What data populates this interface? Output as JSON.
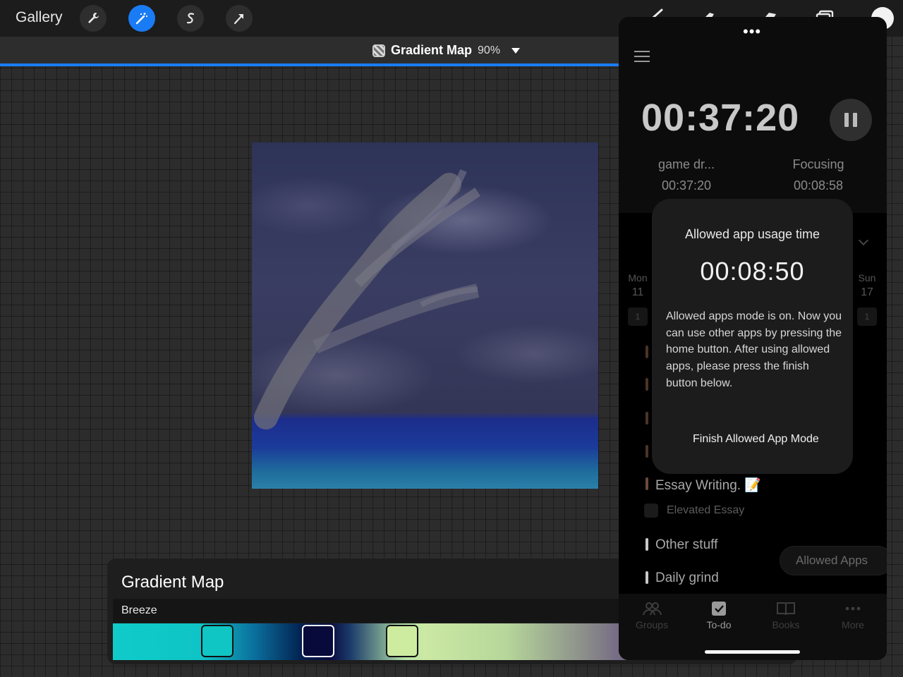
{
  "topbar": {
    "gallery_label": "Gallery",
    "tools": [
      {
        "icon": "wrench-icon"
      },
      {
        "icon": "magic-wand-icon"
      },
      {
        "icon": "selection-s-icon"
      },
      {
        "icon": "transform-arrow-icon"
      }
    ],
    "right_tools": [
      "brush-icon",
      "smudge-icon",
      "eraser-icon",
      "layers-icon",
      "color-circle"
    ]
  },
  "layer": {
    "name": "Gradient Map",
    "percent": "90%"
  },
  "gradient_panel": {
    "title": "Gradient Map",
    "preset_name": "Breeze",
    "stop_colors": [
      "#0fc6c4",
      "#070a3a",
      "#cdeca0"
    ]
  },
  "phone": {
    "main_timer": "00:37:20",
    "stats": [
      {
        "label": "game dr...",
        "value": "00:37:20"
      },
      {
        "label": "Focusing",
        "value": "00:08:58"
      }
    ],
    "week": {
      "start_day": "Mon",
      "start_num": "11",
      "start_count": "1",
      "end_day": "Sun",
      "end_num": "17",
      "end_count": "1"
    },
    "groups": [
      {
        "label": "Essay Writing. 📝",
        "color": "#6b4a3a"
      },
      {
        "label": "Other stuff",
        "color": "#c8c8c8"
      },
      {
        "label": "Daily grind",
        "color": "#c8c8c8"
      }
    ],
    "sub_item": "Elevated Essay",
    "allowed_apps_label": "Allowed Apps",
    "tabs": [
      {
        "label": "Groups",
        "icon": "groups-icon"
      },
      {
        "label": "To-do",
        "icon": "checkbox-icon"
      },
      {
        "label": "Books",
        "icon": "book-icon"
      },
      {
        "label": "More",
        "icon": "more-dots-icon"
      }
    ]
  },
  "popup": {
    "title": "Allowed app usage time",
    "time": "00:08:50",
    "message": "Allowed apps mode is on. Now you can use other apps by pressing the home button. After using allowed apps, please press the finish button below.",
    "finish_label": "Finish Allowed App Mode"
  }
}
